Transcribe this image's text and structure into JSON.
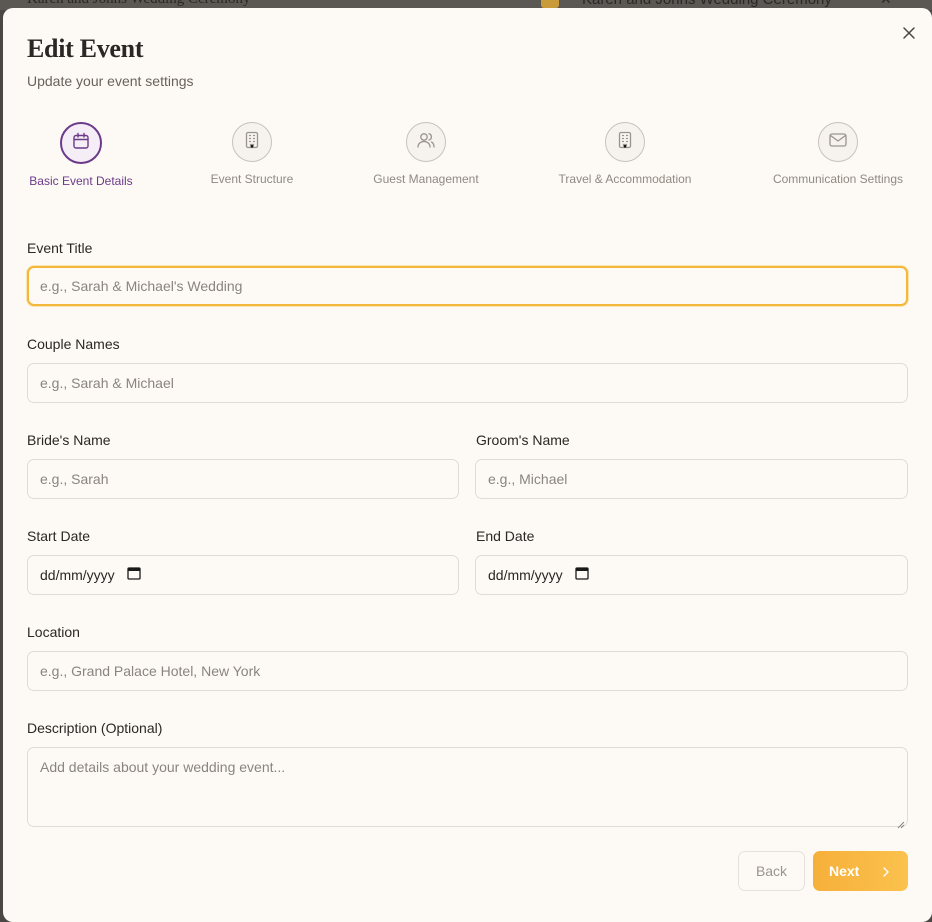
{
  "backdrop": {
    "left_title": "Karen and Johns Wedding Ceremony",
    "right_title": "Karen and Johns Wedding Ceremony"
  },
  "modal": {
    "title": "Edit Event",
    "subtitle": "Update your event settings"
  },
  "steps": [
    {
      "label": "Basic Event Details",
      "icon": "calendar-icon",
      "active": true
    },
    {
      "label": "Event Structure",
      "icon": "building-icon",
      "active": false
    },
    {
      "label": "Guest Management",
      "icon": "users-icon",
      "active": false
    },
    {
      "label": "Travel & Accommodation",
      "icon": "building-icon",
      "active": false
    },
    {
      "label": "Communication Settings",
      "icon": "mail-icon",
      "active": false
    }
  ],
  "form": {
    "event_title": {
      "label": "Event Title",
      "placeholder": "e.g., Sarah & Michael's Wedding"
    },
    "couple_names": {
      "label": "Couple Names",
      "placeholder": "e.g., Sarah & Michael"
    },
    "bride_name": {
      "label": "Bride's Name",
      "placeholder": "e.g., Sarah"
    },
    "groom_name": {
      "label": "Groom's Name",
      "placeholder": "e.g., Michael"
    },
    "start_date": {
      "label": "Start Date",
      "value": "dd/mm/yyyy"
    },
    "end_date": {
      "label": "End Date",
      "value": "dd/mm/yyyy"
    },
    "location": {
      "label": "Location",
      "placeholder": "e.g., Grand Palace Hotel, New York"
    },
    "description": {
      "label": "Description (Optional)",
      "placeholder": "Add details about your wedding event..."
    }
  },
  "actions": {
    "back_label": "Back",
    "next_label": "Next"
  },
  "colors": {
    "accent_purple": "#6b3a8a",
    "accent_orange": "#f6b03a",
    "focus_ring": "#f3b73b"
  }
}
